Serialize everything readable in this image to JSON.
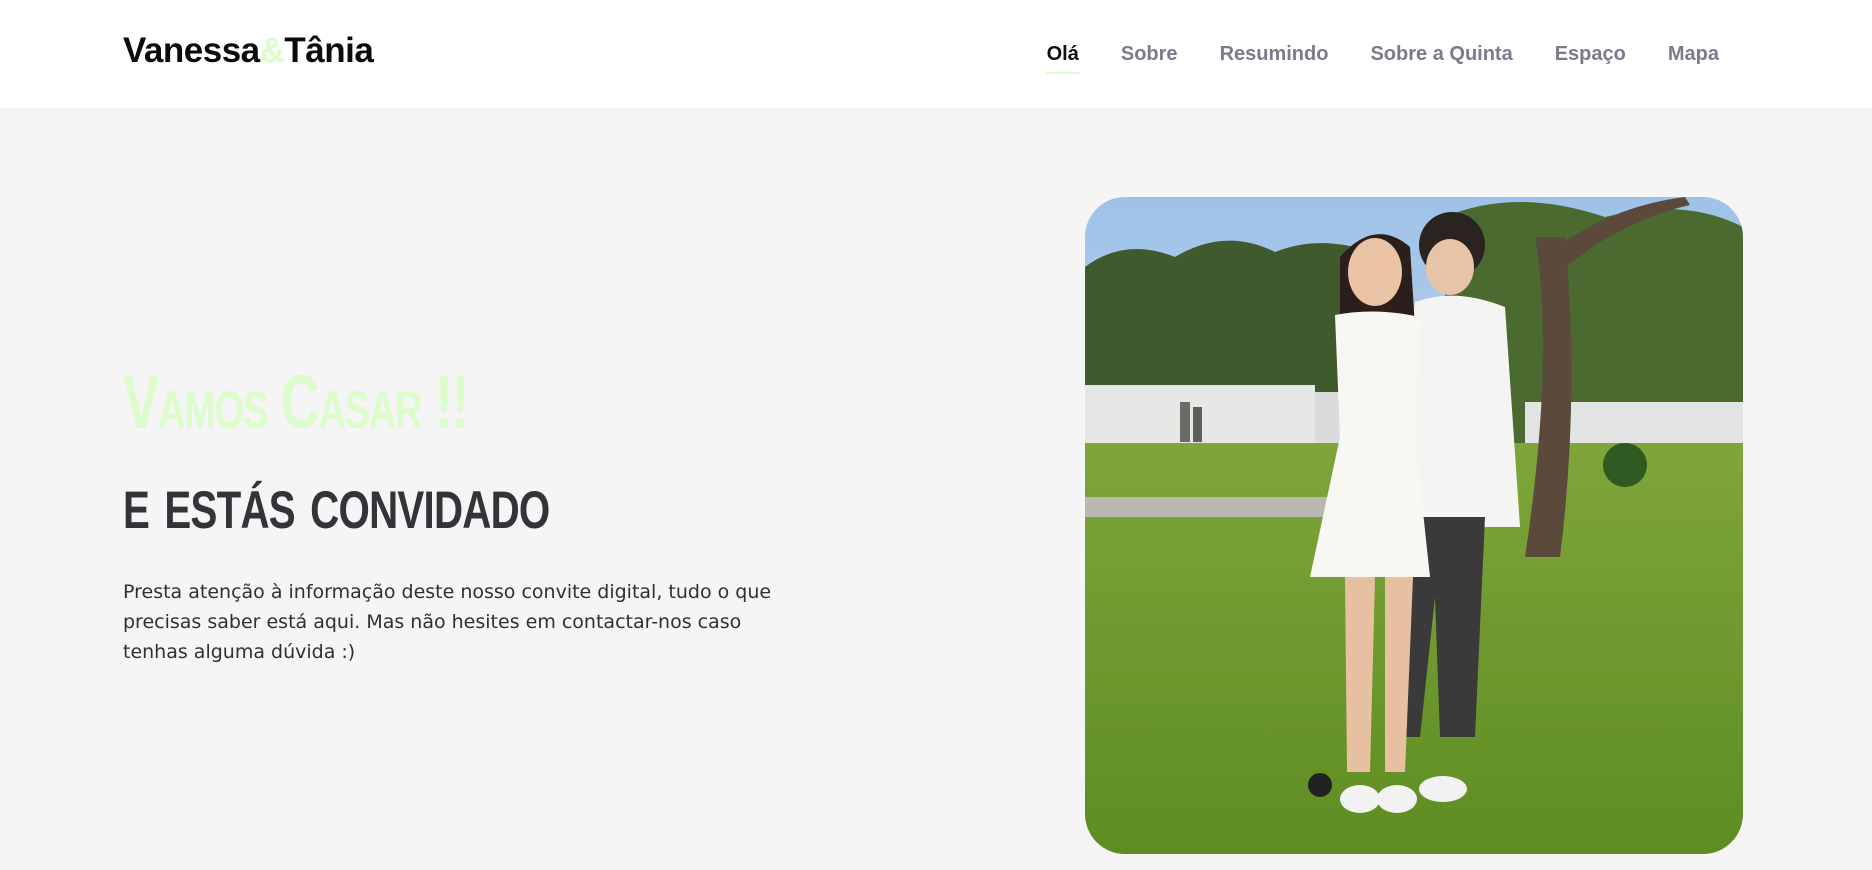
{
  "brand": {
    "first": "Vanessa",
    "amp": "&",
    "second": "Tânia"
  },
  "nav": {
    "items": [
      {
        "label": "Olá",
        "active": true
      },
      {
        "label": "Sobre",
        "active": false
      },
      {
        "label": "Resumindo",
        "active": false
      },
      {
        "label": "Sobre a Quinta",
        "active": false
      },
      {
        "label": "Espaço",
        "active": false
      },
      {
        "label": "Mapa",
        "active": false
      }
    ]
  },
  "hero": {
    "headline_1": "Vamos Casar !!",
    "headline_2": "e estás convidado",
    "lead": "Presta atenção à informação deste nosso convite digital, tudo o que precisas saber está aqui. Mas não hesites em contactar-nos caso tenhas alguma dúvida :)"
  },
  "colors": {
    "accent": "#dcfccb",
    "background": "#f5f5f5",
    "nav_inactive": "#7b7b8c",
    "heading_dark": "#33333a"
  }
}
